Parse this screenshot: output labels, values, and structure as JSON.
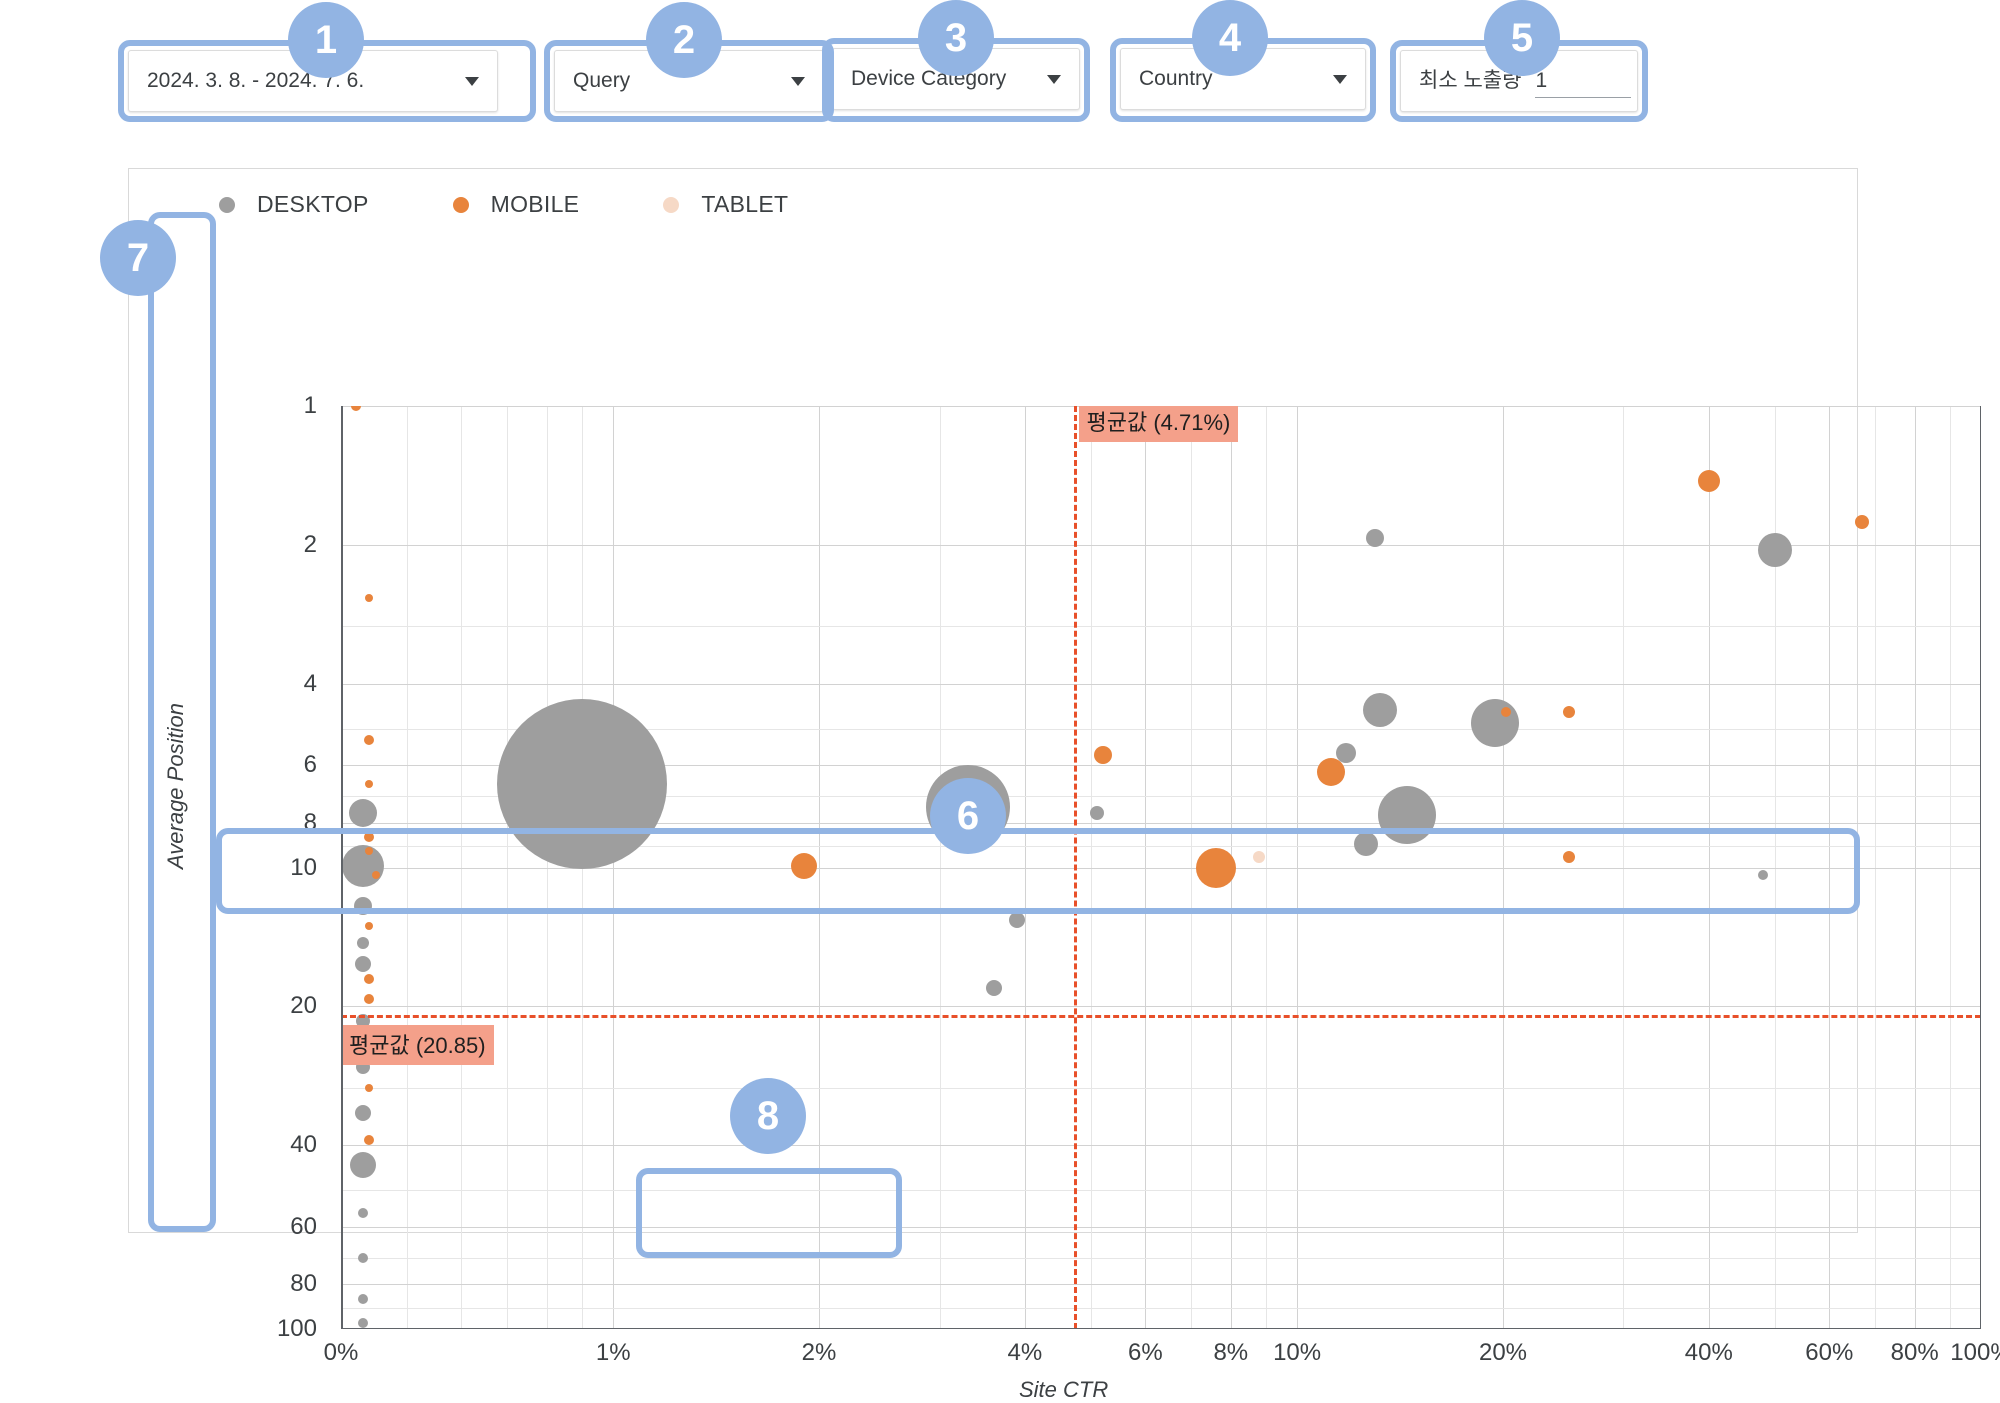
{
  "filters": [
    {
      "id": "date-range",
      "label": "2024. 3. 8. - 2024. 7. 6.",
      "type": "dropdown"
    },
    {
      "id": "query",
      "label": "Query",
      "type": "dropdown"
    },
    {
      "id": "device-category",
      "label": "Device Category",
      "type": "dropdown"
    },
    {
      "id": "country",
      "label": "Country",
      "type": "dropdown"
    },
    {
      "id": "min-impressions",
      "label": "최소 노출량",
      "value": "1",
      "type": "number"
    }
  ],
  "annotations": [
    {
      "num": "1",
      "target": "date-range-filter"
    },
    {
      "num": "2",
      "target": "query-filter"
    },
    {
      "num": "3",
      "target": "device-category-filter"
    },
    {
      "num": "4",
      "target": "country-filter"
    },
    {
      "num": "5",
      "target": "min-impressions-filter"
    },
    {
      "num": "6",
      "target": "average-position-reference-line"
    },
    {
      "num": "7",
      "target": "y-axis"
    },
    {
      "num": "8",
      "target": "x-axis"
    }
  ],
  "chart_data": {
    "type": "scatter",
    "title": "",
    "xlabel": "Site CTR",
    "ylabel": "Average Position",
    "xscale": "log",
    "yscale": "log",
    "xlim": [
      0.4,
      100
    ],
    "ylim": [
      1,
      100
    ],
    "y_inverted": true,
    "grid": true,
    "legend_position": "top-left",
    "xticks": [
      "0%",
      "1%",
      "2%",
      "4%",
      "6%",
      "8%",
      "10%",
      "20%",
      "40%",
      "60%",
      "80%",
      "100%"
    ],
    "xtick_values": [
      0.4,
      1,
      2,
      4,
      6,
      8,
      10,
      20,
      40,
      60,
      80,
      100
    ],
    "yticks": [
      "1",
      "2",
      "4",
      "6",
      "8",
      "10",
      "20",
      "40",
      "60",
      "80",
      "100"
    ],
    "ytick_values": [
      1,
      2,
      4,
      6,
      8,
      10,
      20,
      40,
      60,
      80,
      100
    ],
    "legend": [
      {
        "name": "DESKTOP",
        "color": "#9e9e9e"
      },
      {
        "name": "MOBILE",
        "color": "#e8843c"
      },
      {
        "name": "TABLET",
        "color": "#f6d9c6"
      }
    ],
    "reference_lines": [
      {
        "axis": "x",
        "label": "평균값 (4.71%)",
        "value": 4.71,
        "color": "#e8502a",
        "style": "dashed"
      },
      {
        "axis": "y",
        "label": "평균값 (20.85)",
        "value": 20.85,
        "color": "#e8502a",
        "style": "dashed"
      }
    ],
    "bubble_size_encodes": "impressions",
    "points": [
      {
        "series": "MOBILE",
        "x": 0.42,
        "y": 1.0,
        "r": 5
      },
      {
        "series": "MOBILE",
        "x": 40,
        "y": 1.45,
        "r": 11
      },
      {
        "series": "DESKTOP",
        "x": 13,
        "y": 1.93,
        "r": 9
      },
      {
        "series": "DESKTOP",
        "x": 50,
        "y": 2.05,
        "r": 17
      },
      {
        "series": "MOBILE",
        "x": 67,
        "y": 1.78,
        "r": 7
      },
      {
        "series": "DESKTOP",
        "x": 0.9,
        "y": 6.6,
        "r": 85
      },
      {
        "series": "DESKTOP",
        "x": 3.3,
        "y": 7.4,
        "r": 42
      },
      {
        "series": "DESKTOP",
        "x": 13.2,
        "y": 4.55,
        "r": 17
      },
      {
        "series": "DESKTOP",
        "x": 19.5,
        "y": 4.85,
        "r": 24
      },
      {
        "series": "MOBILE",
        "x": 20.2,
        "y": 4.6,
        "r": 5
      },
      {
        "series": "MOBILE",
        "x": 25,
        "y": 4.6,
        "r": 6
      },
      {
        "series": "MOBILE",
        "x": 5.2,
        "y": 5.7,
        "r": 9
      },
      {
        "series": "DESKTOP",
        "x": 5.1,
        "y": 7.6,
        "r": 7
      },
      {
        "series": "DESKTOP",
        "x": 11.8,
        "y": 5.65,
        "r": 10
      },
      {
        "series": "MOBILE",
        "x": 11.2,
        "y": 6.2,
        "r": 14
      },
      {
        "series": "DESKTOP",
        "x": 14.5,
        "y": 7.7,
        "r": 29
      },
      {
        "series": "DESKTOP",
        "x": 12.6,
        "y": 8.9,
        "r": 12
      },
      {
        "series": "MOBILE",
        "x": 7.6,
        "y": 10.0,
        "r": 20
      },
      {
        "series": "TABLET",
        "x": 8.8,
        "y": 9.5,
        "r": 6
      },
      {
        "series": "MOBILE",
        "x": 1.9,
        "y": 9.9,
        "r": 13
      },
      {
        "series": "MOBILE",
        "x": 25,
        "y": 9.5,
        "r": 6
      },
      {
        "series": "DESKTOP",
        "x": 48,
        "y": 10.4,
        "r": 5
      },
      {
        "series": "DESKTOP",
        "x": 3.9,
        "y": 13.0,
        "r": 8
      },
      {
        "series": "DESKTOP",
        "x": 3.6,
        "y": 18.2,
        "r": 8
      },
      {
        "series": "DESKTOP",
        "x": 0.43,
        "y": 7.6,
        "r": 14
      },
      {
        "series": "DESKTOP",
        "x": 0.43,
        "y": 9.9,
        "r": 21
      },
      {
        "series": "MOBILE",
        "x": 0.44,
        "y": 8.6,
        "r": 5
      },
      {
        "series": "MOBILE",
        "x": 0.44,
        "y": 9.2,
        "r": 4
      },
      {
        "series": "MOBILE",
        "x": 0.45,
        "y": 10.4,
        "r": 4
      },
      {
        "series": "DESKTOP",
        "x": 0.43,
        "y": 12.1,
        "r": 9
      },
      {
        "series": "MOBILE",
        "x": 0.44,
        "y": 13.4,
        "r": 4
      },
      {
        "series": "DESKTOP",
        "x": 0.43,
        "y": 14.6,
        "r": 6
      },
      {
        "series": "DESKTOP",
        "x": 0.43,
        "y": 16.2,
        "r": 8
      },
      {
        "series": "MOBILE",
        "x": 0.44,
        "y": 17.4,
        "r": 5
      },
      {
        "series": "MOBILE",
        "x": 0.44,
        "y": 19.3,
        "r": 5
      },
      {
        "series": "DESKTOP",
        "x": 0.43,
        "y": 21.5,
        "r": 7
      },
      {
        "series": "MOBILE",
        "x": 0.44,
        "y": 23.4,
        "r": 4
      },
      {
        "series": "DESKTOP",
        "x": 0.43,
        "y": 27,
        "r": 7
      },
      {
        "series": "MOBILE",
        "x": 0.44,
        "y": 30,
        "r": 4
      },
      {
        "series": "DESKTOP",
        "x": 0.43,
        "y": 34,
        "r": 8
      },
      {
        "series": "MOBILE",
        "x": 0.44,
        "y": 39,
        "r": 5
      },
      {
        "series": "DESKTOP",
        "x": 0.43,
        "y": 44,
        "r": 13
      },
      {
        "series": "DESKTOP",
        "x": 0.43,
        "y": 56,
        "r": 5
      },
      {
        "series": "DESKTOP",
        "x": 0.43,
        "y": 70,
        "r": 5
      },
      {
        "series": "DESKTOP",
        "x": 0.43,
        "y": 86,
        "r": 5
      },
      {
        "series": "DESKTOP",
        "x": 0.43,
        "y": 97,
        "r": 5
      },
      {
        "series": "MOBILE",
        "x": 0.44,
        "y": 2.6,
        "r": 4
      },
      {
        "series": "MOBILE",
        "x": 0.44,
        "y": 5.3,
        "r": 5
      },
      {
        "series": "MOBILE",
        "x": 0.44,
        "y": 6.6,
        "r": 4
      }
    ]
  }
}
